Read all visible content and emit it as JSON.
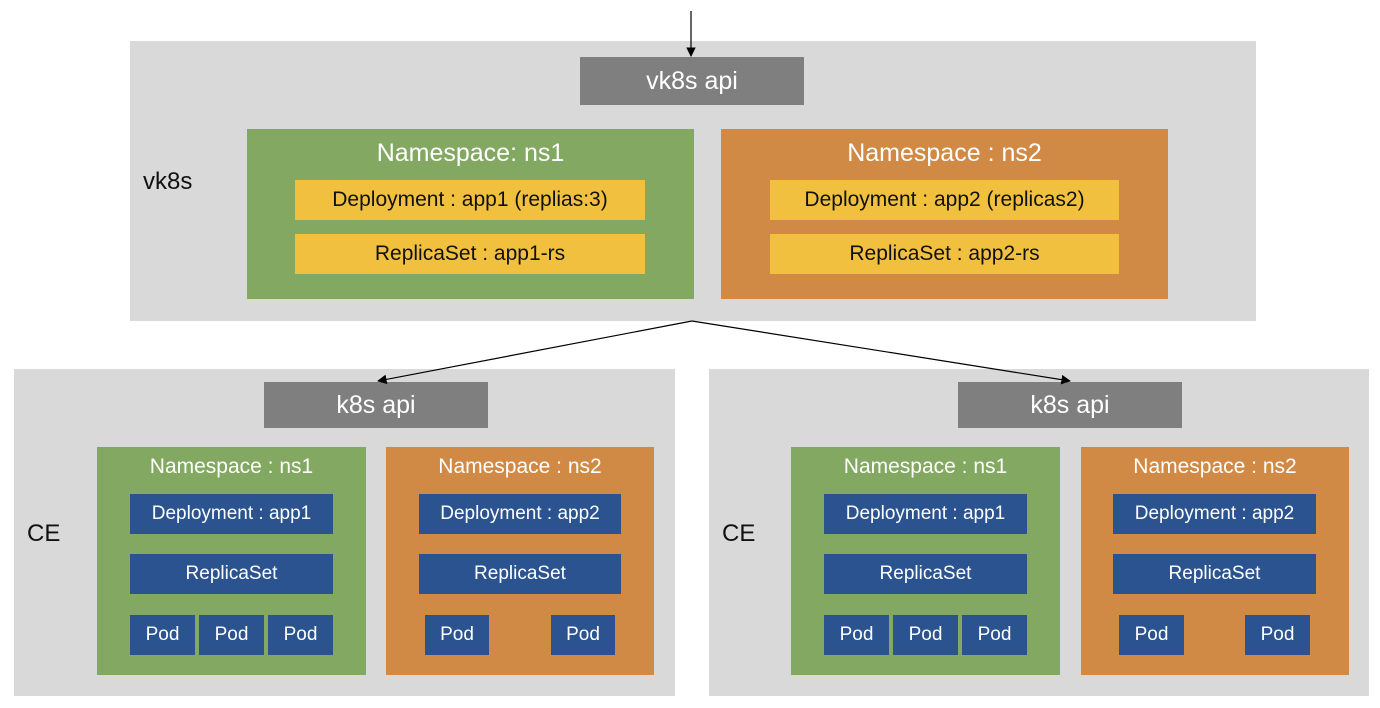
{
  "colors": {
    "cluster_bg": "#d9d9d9",
    "api_box": "#7f7f7f",
    "namespace_ns1": "#82a862",
    "namespace_ns2": "#d08a46",
    "vk8s_resource": "#f0c03e",
    "ce_resource": "#2a5390"
  },
  "vk8s": {
    "label": "vk8s",
    "api": "vk8s api",
    "namespaces": [
      {
        "title": "Namespace: ns1",
        "deployment": "Deployment : app1 (replias:3)",
        "replicaset": "ReplicaSet : app1-rs"
      },
      {
        "title": "Namespace : ns2",
        "deployment": "Deployment : app2 (replicas2)",
        "replicaset": "ReplicaSet : app2-rs"
      }
    ]
  },
  "ce_sites": [
    {
      "label": "CE",
      "api": "k8s api",
      "namespaces": [
        {
          "title": "Namespace : ns1",
          "deployment": "Deployment : app1",
          "replicaset": "ReplicaSet",
          "pods": [
            "Pod",
            "Pod",
            "Pod"
          ]
        },
        {
          "title": "Namespace : ns2",
          "deployment": "Deployment : app2",
          "replicaset": "ReplicaSet",
          "pods": [
            "Pod",
            "Pod"
          ]
        }
      ]
    },
    {
      "label": "CE",
      "api": "k8s api",
      "namespaces": [
        {
          "title": "Namespace : ns1",
          "deployment": "Deployment : app1",
          "replicaset": "ReplicaSet",
          "pods": [
            "Pod",
            "Pod",
            "Pod"
          ]
        },
        {
          "title": "Namespace : ns2",
          "deployment": "Deployment : app2",
          "replicaset": "ReplicaSet",
          "pods": [
            "Pod",
            "Pod"
          ]
        }
      ]
    }
  ]
}
